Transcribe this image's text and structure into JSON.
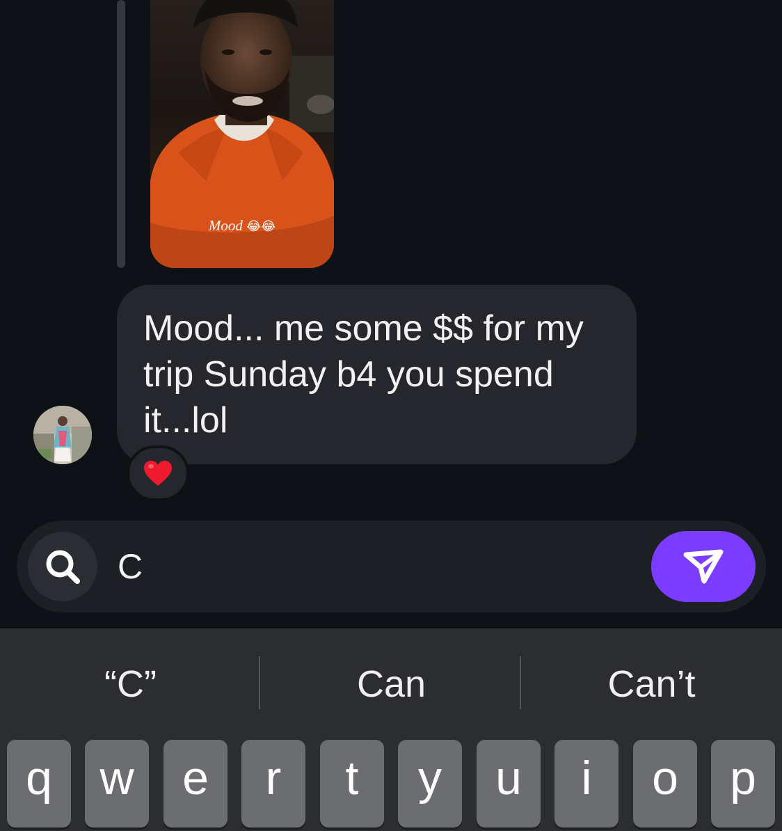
{
  "story": {
    "caption": "Mood",
    "caption_emoji": "😂😂"
  },
  "message": {
    "text": "Mood... me some $$ for my trip Sunday b4 you spend it...lol",
    "reaction": "❤️"
  },
  "composer": {
    "value": "C"
  },
  "keyboard": {
    "suggestions": [
      "“C”",
      "Can",
      "Can’t"
    ],
    "keys_row1": [
      "q",
      "w",
      "e",
      "r",
      "t",
      "y",
      "u",
      "i",
      "o",
      "p"
    ]
  },
  "colors": {
    "background": "#0e1115",
    "bubble": "#25272c",
    "send_button": "#7c3cff",
    "keyboard": "#2b2d31",
    "key": "#6b6d71"
  }
}
